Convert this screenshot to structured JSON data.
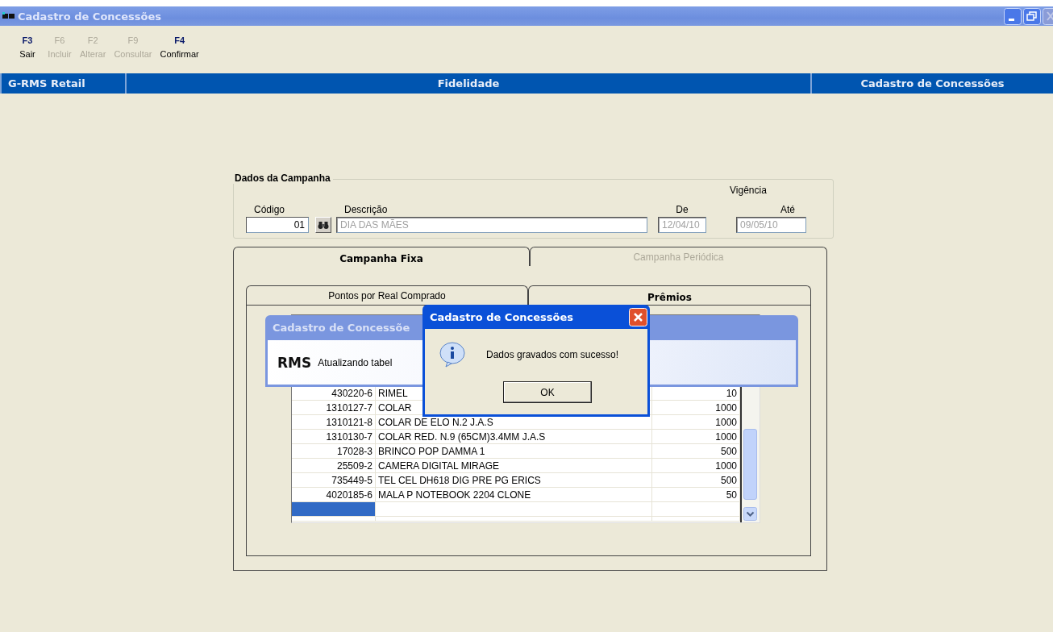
{
  "window": {
    "title": "Cadastro de Concessões"
  },
  "toolbar": [
    {
      "key": "F3",
      "label": "Sair",
      "disabled": false
    },
    {
      "key": "F6",
      "label": "Incluir",
      "disabled": true
    },
    {
      "key": "F2",
      "label": "Alterar",
      "disabled": true
    },
    {
      "key": "F9",
      "label": "Consultar",
      "disabled": true
    },
    {
      "key": "F4",
      "label": "Confirmar",
      "disabled": false
    }
  ],
  "header": {
    "left": "G-RMS Retail",
    "center": "Fidelidade",
    "right": "Cadastro de Concessões"
  },
  "campaign": {
    "title": "Dados da Campanha",
    "codigo_label": "Código",
    "codigo": "01",
    "descricao_label": "Descrição",
    "descricao": "DIA DAS MÃES",
    "vigencia_label": "Vigência",
    "de_label": "De",
    "de": "12/04/10",
    "ate_label": "Até",
    "ate": "09/05/10"
  },
  "tabs": [
    {
      "label": "Campanha Fixa",
      "selected": true,
      "disabled": false
    },
    {
      "label": "Campanha Periódica",
      "selected": false,
      "disabled": true
    }
  ],
  "subtabs": [
    {
      "label": "Pontos por Real Comprado",
      "selected": false,
      "disabled": false
    },
    {
      "label": "Prêmios",
      "selected": true,
      "disabled": false
    }
  ],
  "grid": {
    "rows": [
      {
        "code": "430220-6",
        "description": "RIMEL",
        "points": "10"
      },
      {
        "code": "1310127-7",
        "description": "COLAR",
        "points": "1000"
      },
      {
        "code": "1310121-8",
        "description": "COLAR DE ELO N.2 J.A.S",
        "points": "1000"
      },
      {
        "code": "1310130-7",
        "description": "COLAR RED. N.9 (65CM)3.4MM J.A.S",
        "points": "1000"
      },
      {
        "code": "17028-3",
        "description": "BRINCO POP DAMMA    1",
        "points": "500"
      },
      {
        "code": "25509-2",
        "description": "CAMERA DIGITAL MIRAGE",
        "points": "1000"
      },
      {
        "code": "735449-5",
        "description": "TEL CEL DH618 DIG PRE PG ERICS",
        "points": "500"
      },
      {
        "code": "4020185-6",
        "description": "MALA P NOTEBOOK 2204 CLONE",
        "points": "50"
      }
    ],
    "new_row_selected": true
  },
  "progress": {
    "title": "Cadastro de Concessõe",
    "logo": "RMS",
    "message": "Atualizando tabel"
  },
  "dialog": {
    "title": "Cadastro de Concessões",
    "message": "Dados gravados com sucesso!",
    "button": "OK"
  }
}
